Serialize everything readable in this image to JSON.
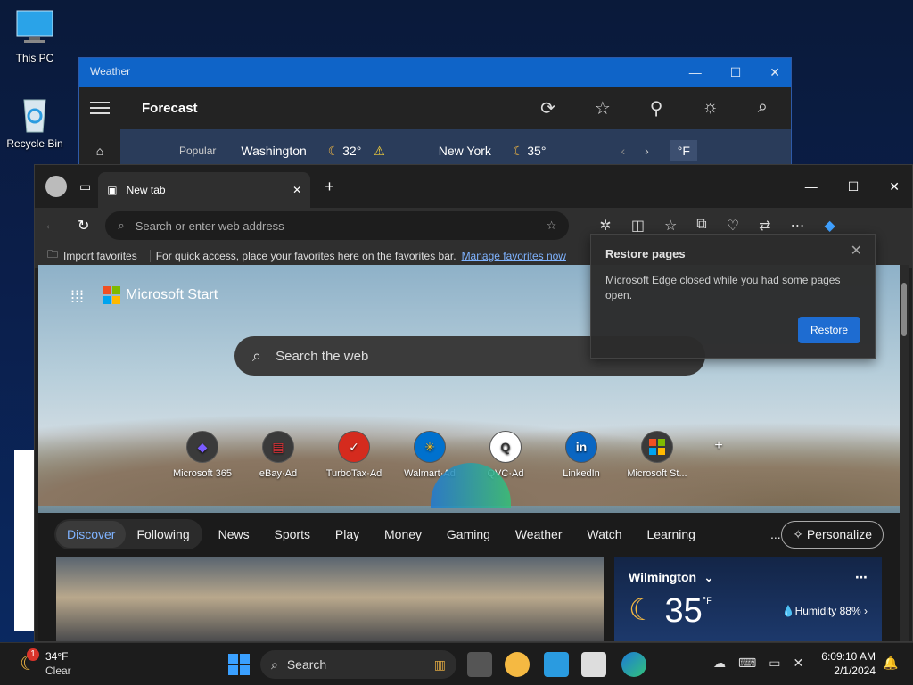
{
  "desktop": {
    "icons": [
      {
        "label": "This PC"
      },
      {
        "label": "Recycle Bin"
      }
    ]
  },
  "weather_app": {
    "window_title": "Weather",
    "header_title": "Forecast",
    "popular_label": "Popular",
    "cities": [
      {
        "name": "Washington",
        "temp": "32°",
        "alert_count": "1"
      },
      {
        "name": "New York",
        "temp": "35°"
      }
    ],
    "unit": "°F"
  },
  "browser": {
    "tab_title": "New tab",
    "address_placeholder": "Search or enter web address",
    "favorites_bar": {
      "import_label": "Import favorites",
      "hint_text": "For quick access, place your favorites here on the favorites bar.",
      "manage_link": "Manage favorites now"
    },
    "start_logo": "Microsoft Start",
    "search_placeholder": "Search the web",
    "quick_links": [
      {
        "label": "Microsoft 365",
        "ad": ""
      },
      {
        "label": "eBay",
        "ad": "Ad"
      },
      {
        "label": "TurboTax",
        "ad": "Ad"
      },
      {
        "label": "Walmart",
        "ad": "Ad"
      },
      {
        "label": "QVC",
        "ad": "Ad"
      },
      {
        "label": "LinkedIn",
        "ad": ""
      },
      {
        "label": "Microsoft St...",
        "ad": ""
      }
    ],
    "feed_tabs": {
      "discover": "Discover",
      "following": "Following",
      "categories": [
        "News",
        "Sports",
        "Play",
        "Money",
        "Gaming",
        "Weather",
        "Watch",
        "Learning"
      ],
      "more": "...",
      "personalize": "Personalize"
    },
    "weather_card": {
      "location": "Wilmington",
      "temp": "35",
      "unit": "°F",
      "humidity": "Humidity 88%"
    },
    "restore_popup": {
      "title": "Restore pages",
      "message": "Microsoft Edge closed while you had some pages open.",
      "button": "Restore"
    }
  },
  "taskbar": {
    "weather_temp": "34°F",
    "weather_cond": "Clear",
    "weather_badge": "1",
    "search_label": "Search",
    "time": "6:09:10 AM",
    "date": "2/1/2024"
  }
}
